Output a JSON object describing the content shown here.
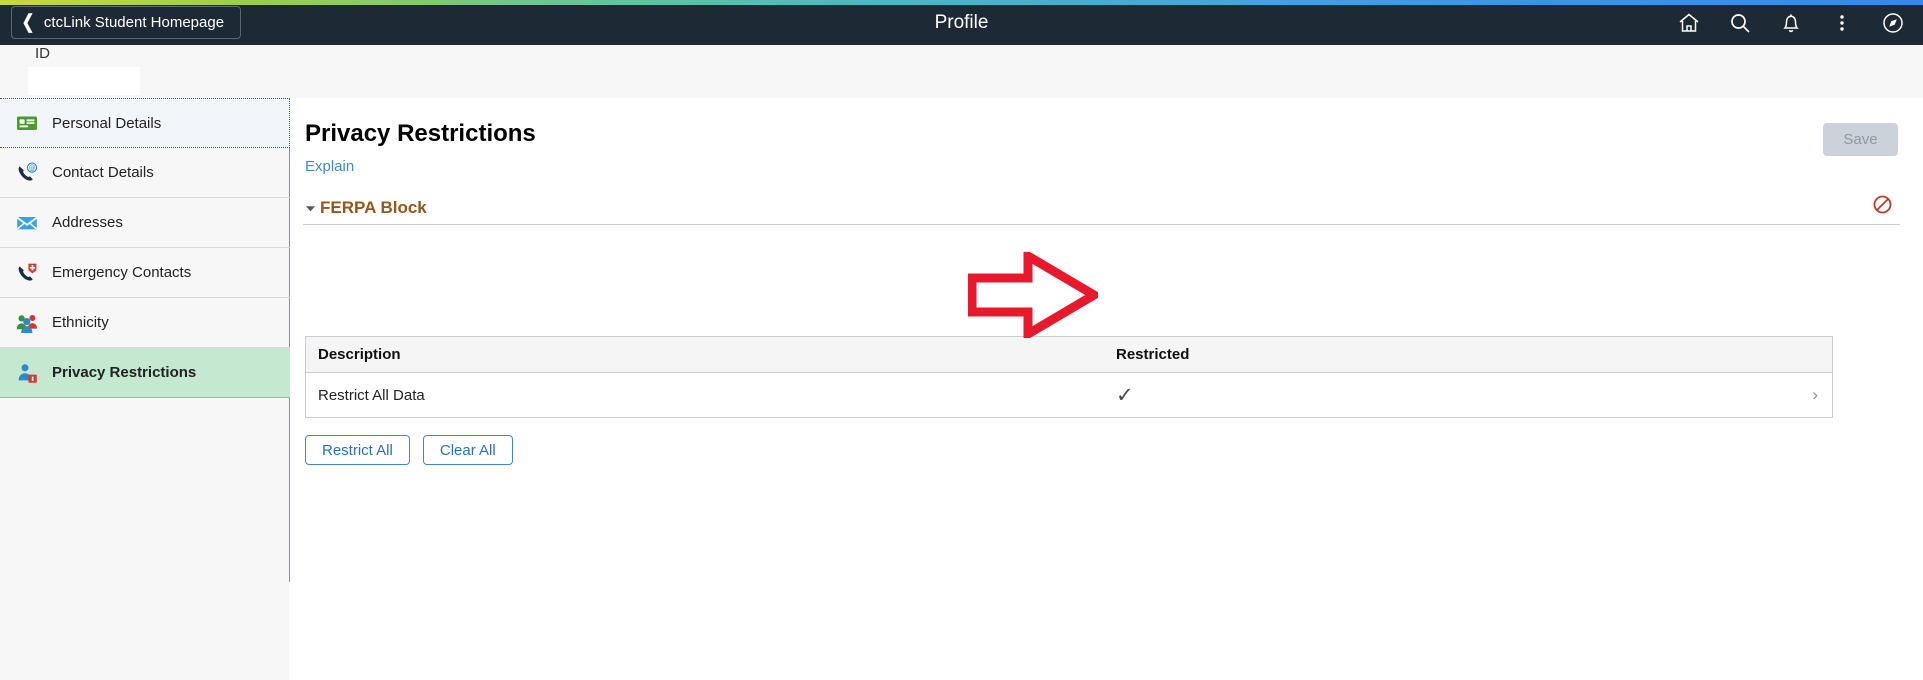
{
  "header": {
    "back_label": "ctcLink Student Homepage",
    "back_icon": "chevron-left-icon",
    "title": "Profile",
    "icons": [
      {
        "name": "home-icon",
        "label": "Home"
      },
      {
        "name": "search-icon",
        "label": "Search"
      },
      {
        "name": "notifications-bell-icon",
        "label": "Notifications"
      },
      {
        "name": "kebab-menu-icon",
        "label": "Actions"
      },
      {
        "name": "compass-navigator-icon",
        "label": "NavBar"
      }
    ],
    "gradient_left": "#c8d93a",
    "gradient_right": "#3b86e8",
    "background": "#1e2936"
  },
  "id_bar": {
    "label": "ID",
    "value": ""
  },
  "sidebar": {
    "items": [
      {
        "label": "Personal Details",
        "icon": "id-card-icon",
        "state": "focused"
      },
      {
        "label": "Contact Details",
        "icon": "phone-at-icon",
        "state": "normal"
      },
      {
        "label": "Addresses",
        "icon": "envelope-icon",
        "state": "normal"
      },
      {
        "label": "Emergency Contacts",
        "icon": "phone-medical-icon",
        "state": "normal"
      },
      {
        "label": "Ethnicity",
        "icon": "people-group-icon",
        "state": "normal"
      },
      {
        "label": "Privacy Restrictions",
        "icon": "person-block-icon",
        "state": "active"
      }
    ],
    "active_background": "#c5e8d0"
  },
  "main": {
    "page_title": "Privacy Restrictions",
    "explain_link": "Explain",
    "save_label": "Save",
    "save_disabled": true,
    "section": {
      "label": "FERPA Block",
      "label_color": "#9a5518",
      "expanded": true,
      "toggle_icon": "triangle-down-icon",
      "status_icon": "prohibited-icon",
      "status_icon_color": "#c0392b"
    },
    "table": {
      "columns": [
        "Description",
        "Restricted"
      ],
      "rows": [
        {
          "description": "Restrict All Data",
          "restricted": "✓",
          "chevron": "›"
        }
      ]
    },
    "buttons": [
      {
        "label": "Restrict All",
        "name": "restrict-all-button"
      },
      {
        "label": "Clear All",
        "name": "clear-all-button"
      }
    ]
  },
  "annotation": {
    "type": "arrow-right",
    "color": "#e8192c",
    "points_to": "restricted-checkmark"
  }
}
